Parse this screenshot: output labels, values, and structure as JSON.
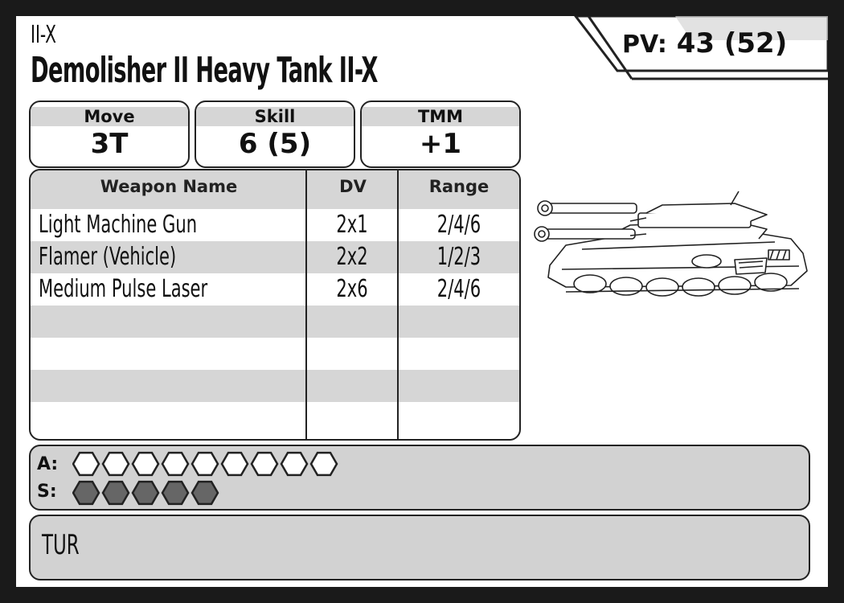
{
  "card": {
    "chassis": "II-X",
    "unit_name": "Demolisher II Heavy Tank II-X",
    "pv_label": "PV:",
    "pv_value": "43 (52)"
  },
  "stats": [
    {
      "label": "Move",
      "value": "3T"
    },
    {
      "label": "Skill",
      "value": "6 (5)"
    },
    {
      "label": "TMM",
      "value": "+1"
    }
  ],
  "weapons": {
    "headers": {
      "name": "Weapon Name",
      "dv": "DV",
      "range": "Range"
    },
    "rows": [
      {
        "name": "Light Machine Gun",
        "dv": "2x1",
        "range": "2/4/6"
      },
      {
        "name": "Flamer (Vehicle)",
        "dv": "2x2",
        "range": "1/2/3"
      },
      {
        "name": "Medium Pulse Laser",
        "dv": "2x6",
        "range": "2/4/6"
      }
    ]
  },
  "damage": {
    "armor_label": "A:",
    "armor_pips": 9,
    "structure_label": "S:",
    "structure_pips": 5
  },
  "special": "TUR",
  "colors": {
    "shade": "#d6d6d6",
    "panel": "#d2d2d2",
    "structure_pip": "#666666",
    "ink": "#222222"
  },
  "image": {
    "icon": "heavy-tank-illustration"
  }
}
